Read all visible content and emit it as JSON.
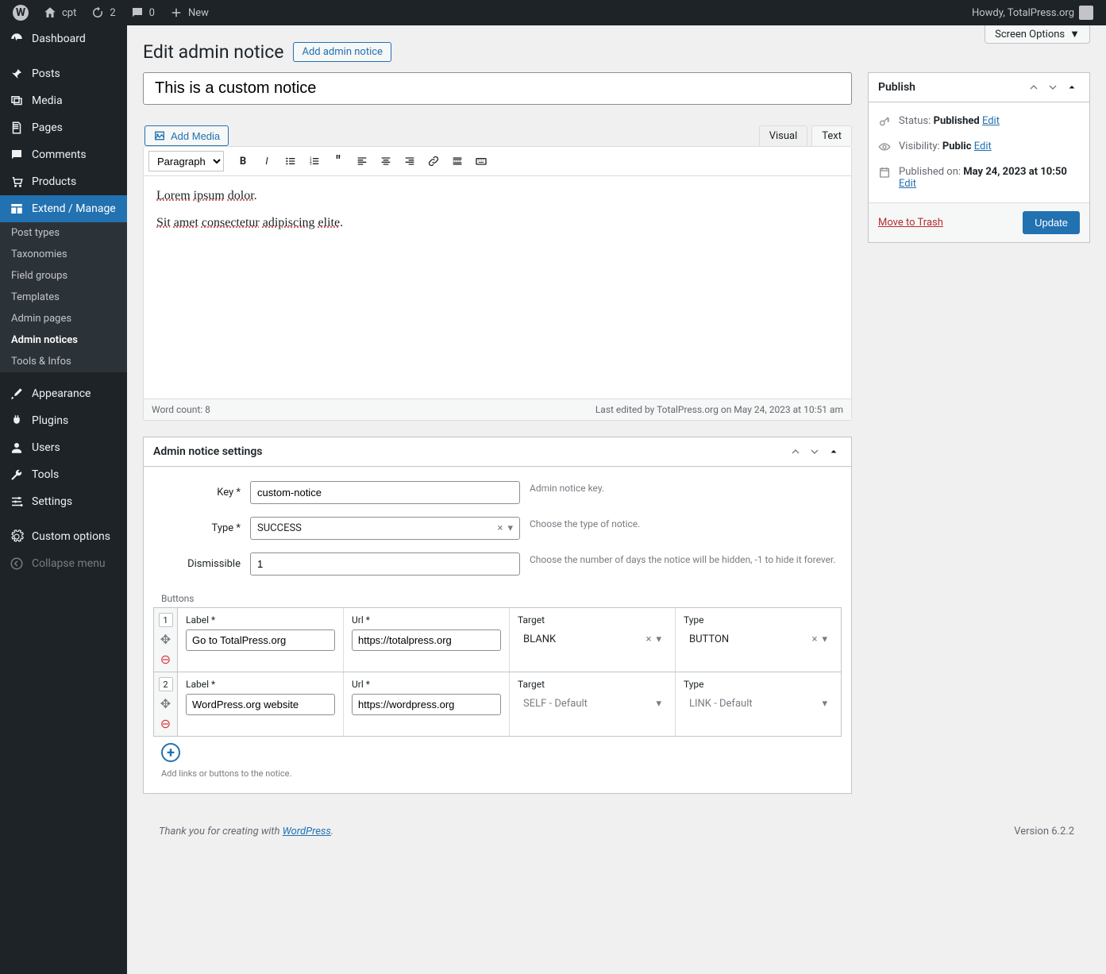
{
  "adminbar": {
    "site": "cpt",
    "updates": "2",
    "comments": "0",
    "new": "New",
    "howdy": "Howdy, TotalPress.org"
  },
  "sidebar": {
    "items": [
      {
        "label": "Dashboard"
      },
      {
        "label": "Posts"
      },
      {
        "label": "Media"
      },
      {
        "label": "Pages"
      },
      {
        "label": "Comments"
      },
      {
        "label": "Products"
      },
      {
        "label": "Extend / Manage"
      },
      {
        "label": "Appearance"
      },
      {
        "label": "Plugins"
      },
      {
        "label": "Users"
      },
      {
        "label": "Tools"
      },
      {
        "label": "Settings"
      },
      {
        "label": "Custom options"
      },
      {
        "label": "Collapse menu"
      }
    ],
    "submenu": [
      {
        "label": "Post types"
      },
      {
        "label": "Taxonomies"
      },
      {
        "label": "Field groups"
      },
      {
        "label": "Templates"
      },
      {
        "label": "Admin pages"
      },
      {
        "label": "Admin notices"
      },
      {
        "label": "Tools & Infos"
      }
    ]
  },
  "screen_options": "Screen Options",
  "page": {
    "title": "Edit admin notice",
    "action": "Add admin notice",
    "post_title": "This is a custom notice"
  },
  "editor": {
    "add_media": "Add Media",
    "tab_visual": "Visual",
    "tab_text": "Text",
    "format": "Paragraph",
    "p1": "Lorem ipsum dolor.",
    "p2": "Sit amet consectetur adipiscing elite.",
    "word_count": "Word count: 8",
    "last_edit": "Last edited by TotalPress.org on May 24, 2023 at 10:51 am"
  },
  "publish": {
    "title": "Publish",
    "status_label": "Status:",
    "status_value": "Published",
    "visibility_label": "Visibility:",
    "visibility_value": "Public",
    "published_label": "Published on:",
    "published_value": "May 24, 2023 at 10:50",
    "edit": "Edit",
    "trash": "Move to Trash",
    "update": "Update"
  },
  "settings": {
    "title": "Admin notice settings",
    "key_label": "Key *",
    "key_value": "custom-notice",
    "key_help": "Admin notice key.",
    "type_label": "Type *",
    "type_value": "SUCCESS",
    "type_help": "Choose the type of notice.",
    "dismissible_label": "Dismissible",
    "dismissible_value": "1",
    "dismissible_help": "Choose the number of days the notice will be hidden, -1 to hide it forever.",
    "buttons_label": "Buttons",
    "buttons_help": "Add links or buttons to the notice.",
    "cols": {
      "label": "Label *",
      "url": "Url *",
      "target": "Target",
      "type": "Type"
    },
    "rows": [
      {
        "num": "1",
        "label": "Go to TotalPress.org",
        "url": "https://totalpress.org",
        "target": "BLANK",
        "type": "BUTTON"
      },
      {
        "num": "2",
        "label": "WordPress.org website",
        "url": "https://wordpress.org",
        "target": "SELF - Default",
        "type": "LINK - Default"
      }
    ]
  },
  "footer": {
    "thanks": "Thank you for creating with ",
    "wp": "WordPress",
    "version": "Version 6.2.2"
  }
}
